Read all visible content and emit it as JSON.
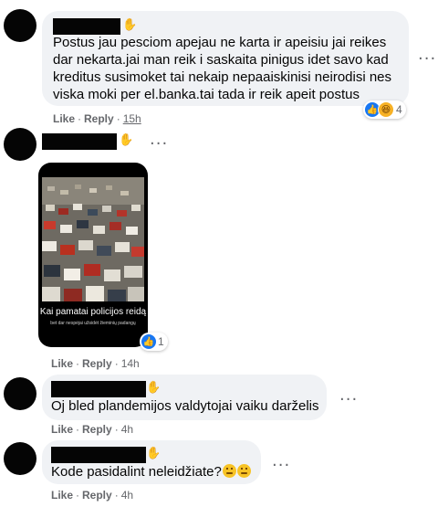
{
  "comments": [
    {
      "text_lines": [
        "Postus jau pesciom apejau ne karta ir apeisiu jai reikes",
        "dar nekarta.jai man reik i saskaita pinigus idet savo kad",
        "kreditus susimoket tai nekaip nepaaiskinisi neirodisi nes",
        "viska moki per el.banka.tai tada ir reik apeit postus"
      ],
      "like_label": "Like",
      "reply_label": "Reply",
      "separator": "·",
      "timestamp": "15h",
      "reaction_count": "4",
      "reaction_icons": [
        "like-icon",
        "haha-icon"
      ]
    },
    {
      "image_caption": "Kai pamatai policijos reidą",
      "image_subcaption": "bet dar nespėjai užsidėt žieminių padangų",
      "like_label": "Like",
      "reply_label": "Reply",
      "separator": "·",
      "timestamp": "14h",
      "reaction_count": "1",
      "reaction_icons": [
        "like-icon"
      ]
    },
    {
      "text_lines": [
        "Oj bled plandemijos valdytojai vaiku darželis"
      ],
      "like_label": "Like",
      "reply_label": "Reply",
      "separator": "·",
      "timestamp": "4h"
    },
    {
      "text_lines": [
        "Kode pasidalint neleidžiate?"
      ],
      "emoji": [
        "thinking-face-icon",
        "thinking-face-icon"
      ],
      "like_label": "Like",
      "reply_label": "Reply",
      "separator": "·",
      "timestamp": "4h"
    }
  ],
  "icons": {
    "more_options": "more-options-icon",
    "wave": "wave-icon"
  },
  "colors": {
    "bubble": "#f0f2f5",
    "like_blue": "#1877f2",
    "meta_gray": "#65676b",
    "text": "#050505"
  }
}
